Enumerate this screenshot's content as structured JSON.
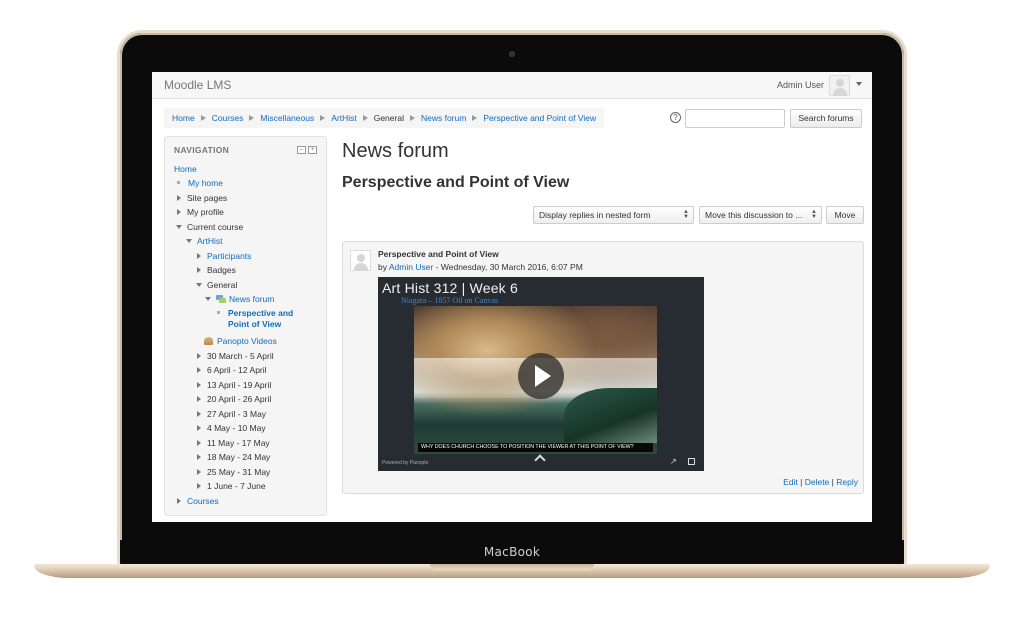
{
  "device": {
    "label": "MacBook"
  },
  "header": {
    "brand": "Moodle LMS",
    "user_name": "Admin User"
  },
  "breadcrumb": {
    "items": [
      "Home",
      "Courses",
      "Miscellaneous",
      "ArtHist",
      "General",
      "News forum",
      "Perspective and Point of View"
    ]
  },
  "search": {
    "help_glyph": "?",
    "button_label": "Search forums",
    "value": ""
  },
  "navigation": {
    "title": "NAVIGATION",
    "controls": [
      "–",
      "+"
    ],
    "items": [
      "Home",
      "My home",
      "Site pages",
      "My profile",
      "Current course",
      "ArtHist",
      "Participants",
      "Badges",
      "General",
      "News forum",
      "Perspective and",
      "Point of View",
      "Panopto Videos",
      "30 March - 5 April",
      "6 April - 12 April",
      "13 April - 19 April",
      "20 April - 26 April",
      "27 April - 3 May",
      "4 May - 10 May",
      "11 May - 17 May",
      "18 May - 24 May",
      "25 May - 31 May",
      "1 June - 7 June",
      "Courses"
    ]
  },
  "main": {
    "title": "News forum",
    "subtitle": "Perspective and Point of View",
    "display_mode": "Display replies in nested form",
    "move_select": "Move this discussion to ...",
    "move_button": "Move"
  },
  "post": {
    "subject": "Perspective and Point of View",
    "by": "by",
    "author": "Admin User",
    "date": "- Wednesday, 30 March 2016, 6:07 PM",
    "video": {
      "title": "Art Hist 312 | Week 6",
      "overlay": "Niagara – 1857 Oil on Canvas",
      "caption": "WHY DOES CHURCH CHOOSE TO POSITION THE VIEWER AT THIS POINT OF VIEW?",
      "powered": "Powered by Panopto",
      "expand_glyph": "↗"
    },
    "actions": {
      "edit": "Edit",
      "delete": "Delete",
      "reply": "Reply",
      "separator": "|"
    }
  },
  "colors": {
    "link": "#0f6cbf",
    "frame": "#0b0b0b",
    "gold": "#d7c2a8"
  }
}
